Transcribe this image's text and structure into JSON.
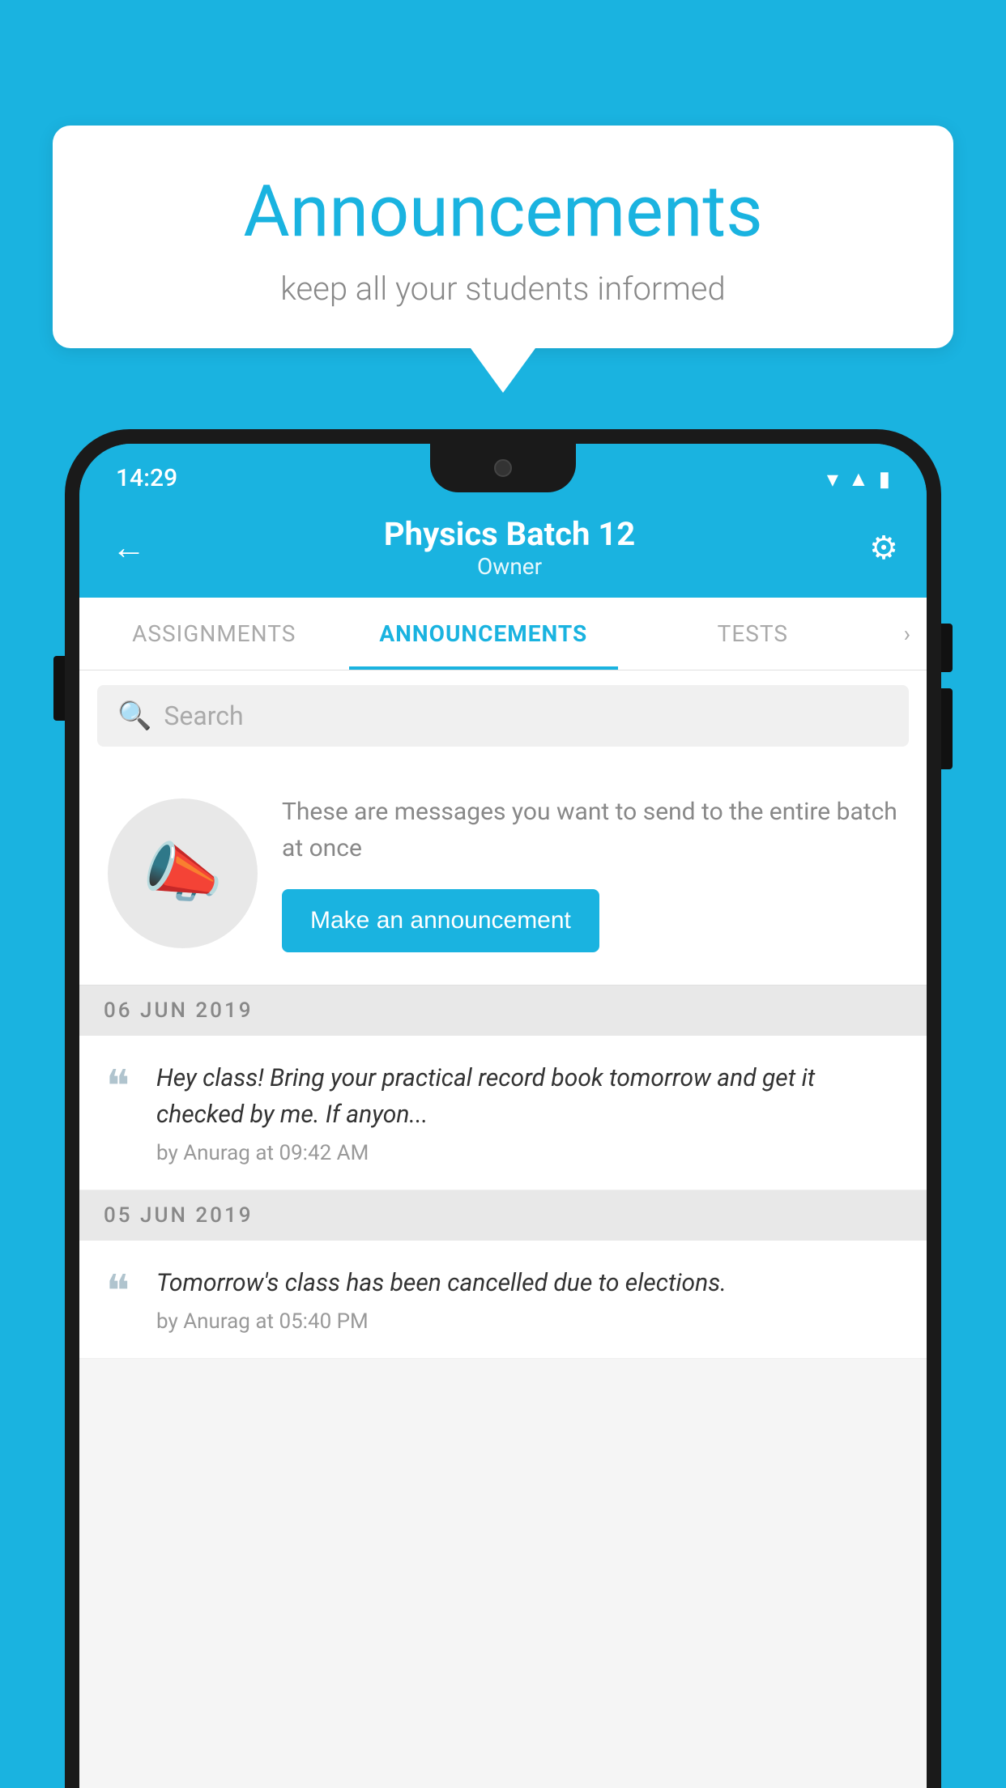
{
  "background_color": "#1ab3e0",
  "speech_bubble": {
    "title": "Announcements",
    "subtitle": "keep all your students informed"
  },
  "phone": {
    "status_bar": {
      "time": "14:29"
    },
    "header": {
      "back_label": "←",
      "title": "Physics Batch 12",
      "subtitle": "Owner",
      "settings_label": "⚙"
    },
    "tabs": [
      {
        "label": "ASSIGNMENTS",
        "active": false
      },
      {
        "label": "ANNOUNCEMENTS",
        "active": true
      },
      {
        "label": "TESTS",
        "active": false
      }
    ],
    "search": {
      "placeholder": "Search"
    },
    "promo": {
      "description": "These are messages you want to send to the entire batch at once",
      "button_label": "Make an announcement"
    },
    "announcements": [
      {
        "date": "06  JUN  2019",
        "text": "Hey class! Bring your practical record book tomorrow and get it checked by me. If anyon...",
        "meta": "by Anurag at 09:42 AM"
      },
      {
        "date": "05  JUN  2019",
        "text": "Tomorrow's class has been cancelled due to elections.",
        "meta": "by Anurag at 05:40 PM"
      }
    ]
  }
}
